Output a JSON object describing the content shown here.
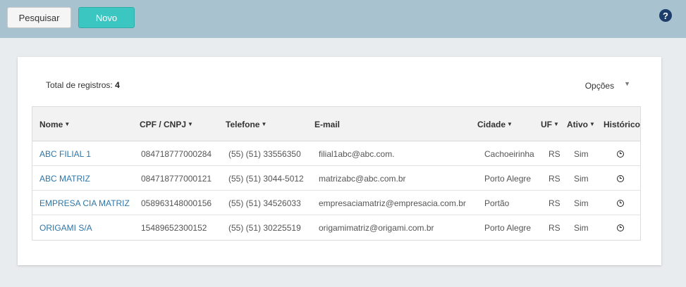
{
  "toolbar": {
    "search_label": "Pesquisar",
    "new_label": "Novo",
    "help_label": "?"
  },
  "panel": {
    "total_label": "Total de registros:",
    "total_value": "4",
    "options_label": "Opções"
  },
  "table": {
    "headers": {
      "nome": "Nome",
      "cpf": "CPF / CNPJ",
      "telefone": "Telefone",
      "email": "E-mail",
      "cidade": "Cidade",
      "uf": "UF",
      "ativo": "Ativo",
      "historico": "Histórico"
    },
    "rows": [
      {
        "nome": "ABC FILIAL 1",
        "cpf": "084718777000284",
        "telefone": "(55) (51) 33556350",
        "email": "filial1abc@abc.com.",
        "cidade": "Cachoeirinha",
        "uf": "RS",
        "ativo": "Sim"
      },
      {
        "nome": "ABC MATRIZ",
        "cpf": "084718777000121",
        "telefone": "(55) (51) 3044-5012",
        "email": "matrizabc@abc.com.br",
        "cidade": "Porto Alegre",
        "uf": "RS",
        "ativo": "Sim"
      },
      {
        "nome": "EMPRESA CIA MATRIZ",
        "cpf": "058963148000156",
        "telefone": "(55) (51) 34526033",
        "email": "empresaciamatriz@empresacia.com.br",
        "cidade": "Portão",
        "uf": "RS",
        "ativo": "Sim"
      },
      {
        "nome": "ORIGAMI S/A",
        "cpf": "15489652300152",
        "telefone": "(55) (51) 30225519",
        "email": "origamimatriz@origami.com.br",
        "cidade": "Porto Alegre",
        "uf": "RS",
        "ativo": "Sim"
      }
    ]
  },
  "icons": {
    "help": "question-circle-icon",
    "sort": "caret-down-icon",
    "history": "clock-icon",
    "options": "caret-down-icon"
  },
  "colors": {
    "topbar": "#a9c2d0",
    "new_button": "#3cc6c2",
    "link": "#2d76a8",
    "help": "#1d3e6a"
  }
}
